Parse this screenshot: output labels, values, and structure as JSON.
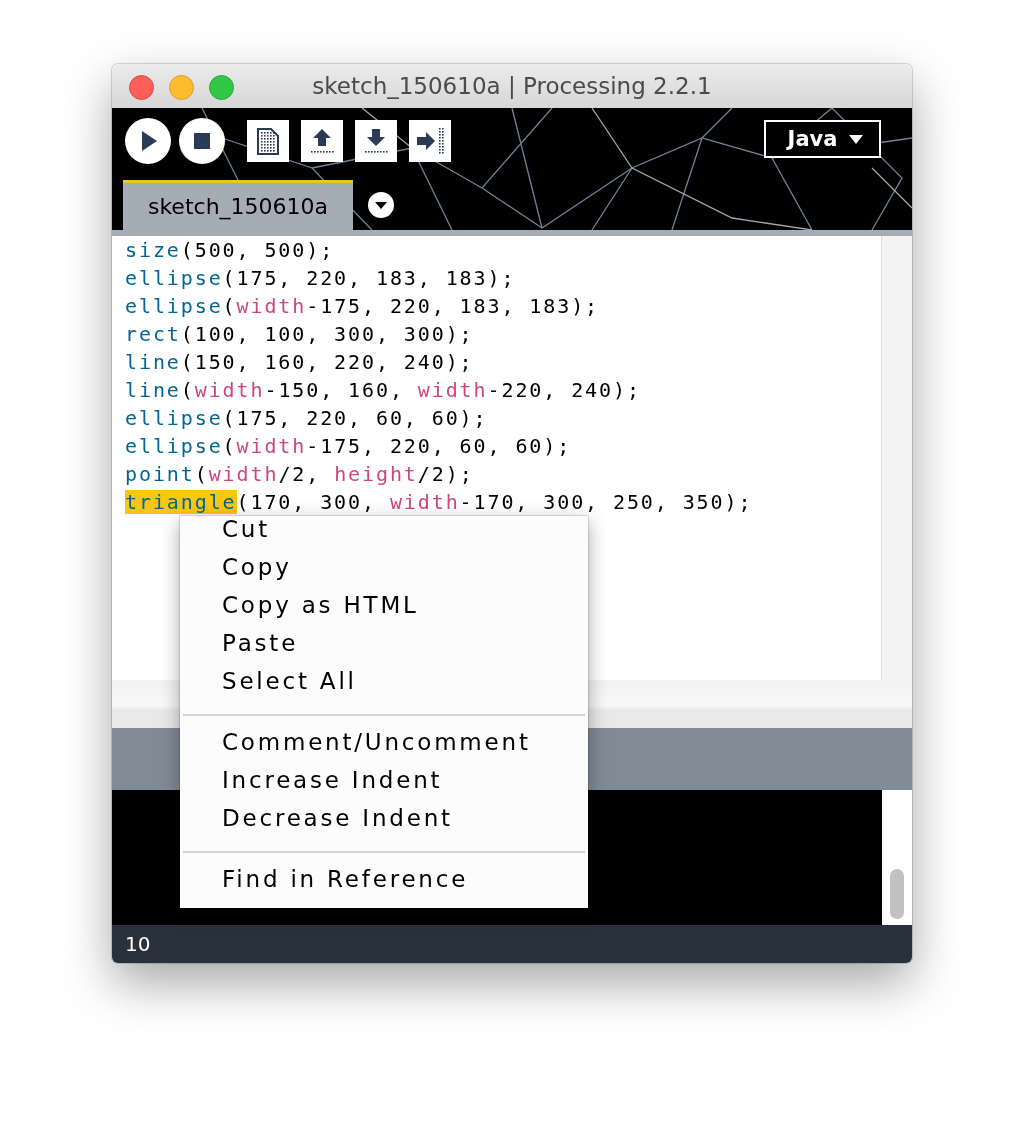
{
  "window": {
    "title": "sketch_150610a | Processing 2.2.1"
  },
  "toolbar": {
    "buttons": [
      {
        "kind": "run"
      },
      {
        "kind": "stop"
      },
      {
        "kind": "new"
      },
      {
        "kind": "open"
      },
      {
        "kind": "save"
      },
      {
        "kind": "export"
      }
    ],
    "mode": {
      "label": "Java"
    }
  },
  "tabs": [
    {
      "label": "sketch_150610a",
      "selected": true
    }
  ],
  "editor": {
    "lines": [
      {
        "tokens": [
          {
            "kind": "function",
            "text": "size",
            "highlighted": false
          },
          {
            "kind": "plain",
            "text": "(500, 500);",
            "highlighted": false
          }
        ]
      },
      {
        "tokens": [
          {
            "kind": "function",
            "text": "ellipse",
            "highlighted": false
          },
          {
            "kind": "plain",
            "text": "(175, 220, 183, 183);",
            "highlighted": false
          }
        ]
      },
      {
        "tokens": [
          {
            "kind": "function",
            "text": "ellipse",
            "highlighted": false
          },
          {
            "kind": "plain",
            "text": "(",
            "highlighted": false
          },
          {
            "kind": "variable",
            "text": "width",
            "highlighted": false
          },
          {
            "kind": "plain",
            "text": "-175, 220, 183, 183);",
            "highlighted": false
          }
        ]
      },
      {
        "tokens": [
          {
            "kind": "function",
            "text": "rect",
            "highlighted": false
          },
          {
            "kind": "plain",
            "text": "(100, 100, 300, 300);",
            "highlighted": false
          }
        ]
      },
      {
        "tokens": [
          {
            "kind": "function",
            "text": "line",
            "highlighted": false
          },
          {
            "kind": "plain",
            "text": "(150, 160, 220, 240);",
            "highlighted": false
          }
        ]
      },
      {
        "tokens": [
          {
            "kind": "function",
            "text": "line",
            "highlighted": false
          },
          {
            "kind": "plain",
            "text": "(",
            "highlighted": false
          },
          {
            "kind": "variable",
            "text": "width",
            "highlighted": false
          },
          {
            "kind": "plain",
            "text": "-150, 160, ",
            "highlighted": false
          },
          {
            "kind": "variable",
            "text": "width",
            "highlighted": false
          },
          {
            "kind": "plain",
            "text": "-220, 240);",
            "highlighted": false
          }
        ]
      },
      {
        "tokens": [
          {
            "kind": "function",
            "text": "ellipse",
            "highlighted": false
          },
          {
            "kind": "plain",
            "text": "(175, 220, 60, 60);",
            "highlighted": false
          }
        ]
      },
      {
        "tokens": [
          {
            "kind": "function",
            "text": "ellipse",
            "highlighted": false
          },
          {
            "kind": "plain",
            "text": "(",
            "highlighted": false
          },
          {
            "kind": "variable",
            "text": "width",
            "highlighted": false
          },
          {
            "kind": "plain",
            "text": "-175, 220, 60, 60);",
            "highlighted": false
          }
        ]
      },
      {
        "tokens": [
          {
            "kind": "function",
            "text": "point",
            "highlighted": false
          },
          {
            "kind": "plain",
            "text": "(",
            "highlighted": false
          },
          {
            "kind": "variable",
            "text": "width",
            "highlighted": false
          },
          {
            "kind": "plain",
            "text": "/2, ",
            "highlighted": false
          },
          {
            "kind": "variable",
            "text": "height",
            "highlighted": false
          },
          {
            "kind": "plain",
            "text": "/2);",
            "highlighted": false
          }
        ]
      },
      {
        "tokens": [
          {
            "kind": "function",
            "text": "triangle",
            "highlighted": true
          },
          {
            "kind": "plain",
            "text": "(170, 300, ",
            "highlighted": false
          },
          {
            "kind": "variable",
            "text": "width",
            "highlighted": false
          },
          {
            "kind": "plain",
            "text": "-170, 300, 250, 350);",
            "highlighted": false
          }
        ]
      }
    ]
  },
  "context_menu": {
    "groups": [
      [
        "Cut",
        "Copy",
        "Copy as HTML",
        "Paste",
        "Select All"
      ],
      [
        "Comment/Uncomment",
        "Increase Indent",
        "Decrease Indent"
      ],
      [
        "Find in Reference"
      ]
    ]
  },
  "status_bar": {
    "line": "10"
  }
}
